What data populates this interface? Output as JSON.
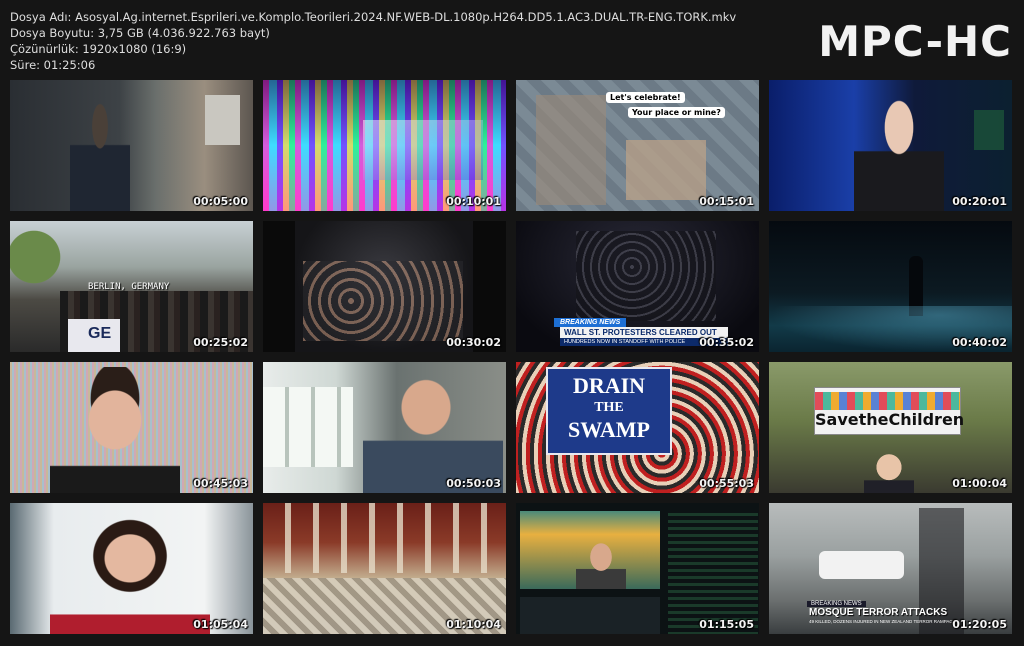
{
  "info": {
    "file_name": "Dosya Adı: Asosyal.Ag.internet.Esprileri.ve.Komplo.Teorileri.2024.NF.WEB-DL.1080p.H264.DD5.1.AC3.DUAL.TR-ENG.TORK.mkv",
    "file_size": "Dosya Boyutu: 3,75 GB (4.036.922.763 bayt)",
    "resolution": "Çözünürlük: 1920x1080 (16:9)",
    "duration": "Süre: 01:25:06"
  },
  "logo": "MPC-HC",
  "thumbnails": [
    {
      "time": "00:05:00"
    },
    {
      "time": "00:10:01"
    },
    {
      "time": "00:15:01",
      "bubble1": "Let's celebrate!",
      "bubble2": "Your place or mine?"
    },
    {
      "time": "00:20:01"
    },
    {
      "time": "00:25:02",
      "caption": "BERLIN, GERMANY",
      "banner": "GE"
    },
    {
      "time": "00:30:02"
    },
    {
      "time": "00:35:02",
      "breaking": "BREAKING NEWS",
      "headline": "WALL ST. PROTESTERS CLEARED OUT",
      "subline": "HUNDREDS NOW IN STANDOFF WITH POLICE"
    },
    {
      "time": "00:40:02"
    },
    {
      "time": "00:45:03"
    },
    {
      "time": "00:50:03"
    },
    {
      "time": "00:55:03",
      "sign1": "DRAIN",
      "sign2": "THE",
      "sign3": "SWAMP"
    },
    {
      "time": "01:00:04",
      "sign": "SavetheChildren"
    },
    {
      "time": "01:05:04"
    },
    {
      "time": "01:10:04"
    },
    {
      "time": "01:15:05"
    },
    {
      "time": "01:20:05",
      "breaking": "BREAKING NEWS",
      "headline": "MOSQUE TERROR ATTACKS",
      "subline": "49 KILLED, DOZENS INJURED IN NEW ZEALAND TERROR RAMPAGE"
    }
  ]
}
